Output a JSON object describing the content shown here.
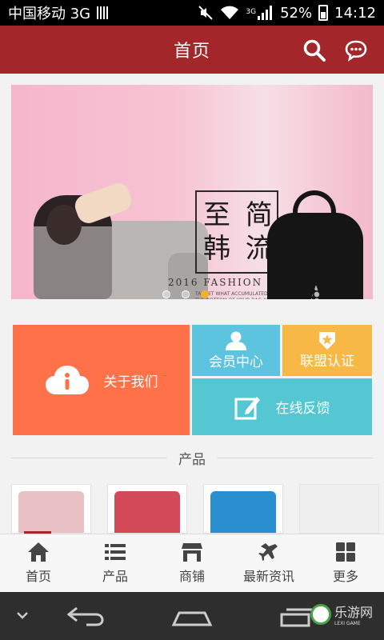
{
  "status_bar": {
    "carrier": "中国移动 3G",
    "network_type": "3G",
    "battery": "52%",
    "time": "14:12"
  },
  "header": {
    "title": "首页"
  },
  "banner": {
    "slogan_line1": "至 简",
    "slogan_line2": "韩 流",
    "fashion_line": "2016 FASHION STYLE",
    "small_text": "TARGET WHAT ACCUMULATED AT THE BOTTOM OF YOUR BAG AND PLACE THESE ITEMS IN A SEPARATE ZIP-UP POUCHES KEEP ALL YOUR POUCHES IN YOUR BAG",
    "slide_count": 3,
    "active_slide": 3
  },
  "tiles": {
    "about": "关于我们",
    "member": "会员中心",
    "alliance": "联盟认证",
    "feedback": "在线反馈"
  },
  "section": {
    "title": "产品"
  },
  "products": [
    "pink leaf wallet",
    "red wallet",
    "blue luggage",
    "placeholder"
  ],
  "tabbar": [
    {
      "label": "首页",
      "icon": "home-icon"
    },
    {
      "label": "产品",
      "icon": "list-icon"
    },
    {
      "label": "商铺",
      "icon": "store-icon"
    },
    {
      "label": "最新资讯",
      "icon": "news-icon"
    },
    {
      "label": "更多",
      "icon": "grid-icon"
    }
  ],
  "watermark": {
    "text": "乐游网",
    "sub": "LEXI GAME"
  },
  "colors": {
    "header": "#a3262b",
    "about_tile": "#ff7149",
    "member_tile": "#5cc4de",
    "alliance_tile": "#f8b845",
    "feedback_tile": "#55c7d2"
  }
}
